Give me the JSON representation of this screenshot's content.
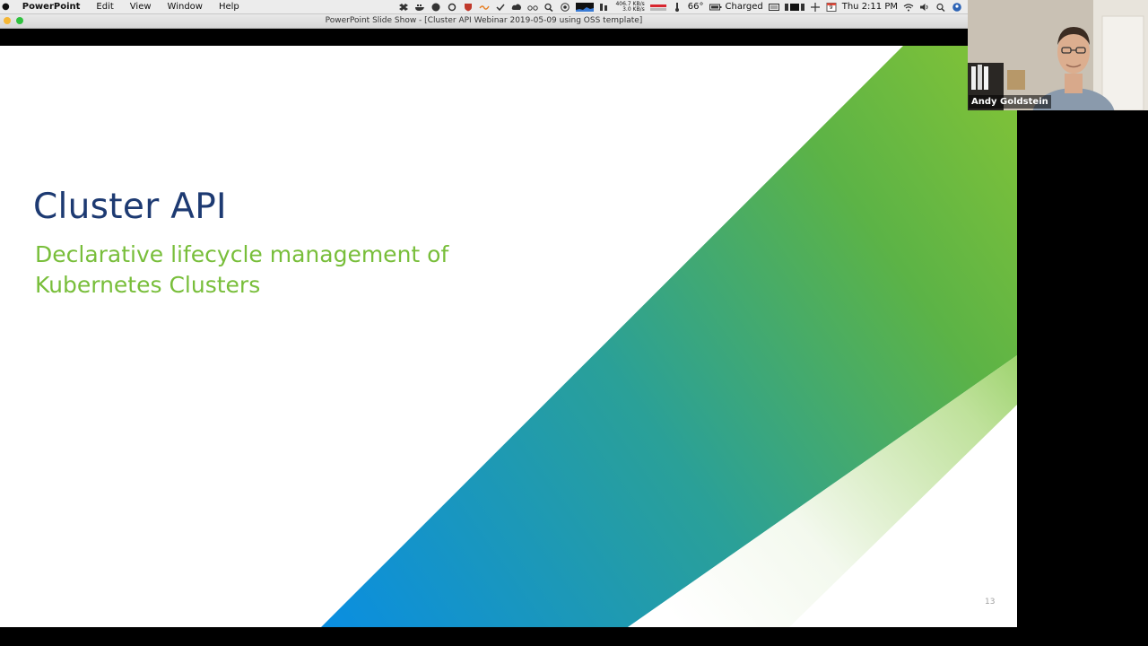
{
  "menubar": {
    "app_name": "PowerPoint",
    "menus": [
      "Edit",
      "View",
      "Window",
      "Help"
    ],
    "status": {
      "net_up": "406.7 KB/s",
      "net_down": "3.0 KB/s",
      "temperature": "66°",
      "battery": "Charged",
      "calendar_day": "9",
      "clock": "Thu 2:11 PM"
    }
  },
  "window": {
    "title": "PowerPoint Slide Show - [Cluster API Webinar 2019-05-09 using OSS template]"
  },
  "slide": {
    "title": "Cluster API",
    "subtitle_line1": "Declarative lifecycle management of",
    "subtitle_line2": "Kubernetes Clusters",
    "page_number": "13",
    "colors": {
      "title": "#1d3a72",
      "subtitle": "#78be3a",
      "band_blue": "#0b8ee0",
      "band_teal": "#2aa098",
      "band_green": "#7bc03a"
    }
  },
  "webcam": {
    "participant_name": "Andy Goldstein"
  }
}
